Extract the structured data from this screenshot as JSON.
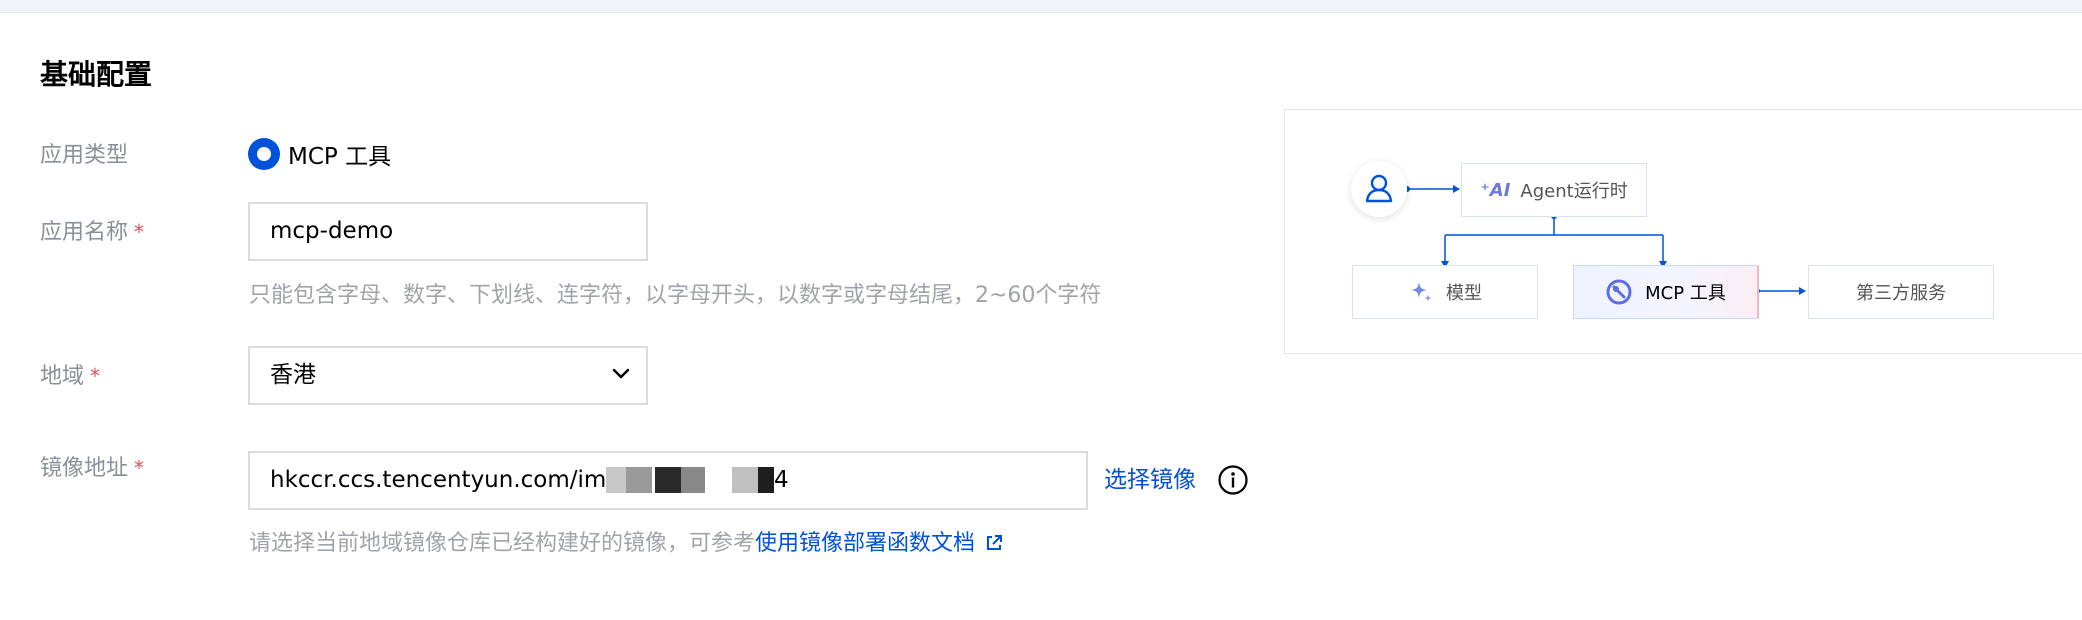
{
  "section": {
    "title": "基础配置"
  },
  "app_type": {
    "label": "应用类型",
    "option": "MCP 工具"
  },
  "app_name": {
    "label": "应用名称",
    "required_mark": "*",
    "value": "mcp-demo",
    "hint": "只能包含字母、数字、下划线、连字符，以字母开头，以数字或字母结尾，2~60个字符"
  },
  "region": {
    "label": "地域",
    "required_mark": "*",
    "value": "香港"
  },
  "image": {
    "label": "镜像地址",
    "required_mark": "*",
    "value_prefix": "hkccr.ccs.tencentyun.com/ima",
    "value_suffix": "4",
    "select_link": "选择镜像",
    "hint_prefix": "请选择当前地域镜像仓库已经构建好的镜像，可参考",
    "hint_link": "使用镜像部署函数文档"
  },
  "diagram": {
    "agent_runtime": "Agent运行时",
    "model": "模型",
    "mcp_tool": "MCP 工具",
    "third_party": "第三方服务"
  },
  "colors": {
    "accent": "#0052d9",
    "required": "#e34d59",
    "hint": "#a0a3a8",
    "label": "#8a8f99"
  }
}
